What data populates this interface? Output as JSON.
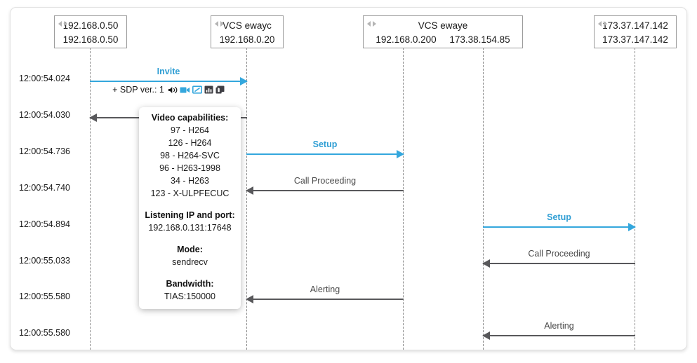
{
  "diagram": {
    "type": "call-flow-ladder-diagram",
    "accent_blue": "#34a7dd",
    "arrow_gray": "#58585b",
    "participants": [
      {
        "id": "endpoint-a",
        "title": "192.168.0.50",
        "addresses": [
          "192.168.0.50"
        ],
        "has_nav_arrows": true
      },
      {
        "id": "vcs-ewayc",
        "title": "VCS ewayc",
        "addresses": [
          "192.168.0.20"
        ],
        "has_nav_arrows": true
      },
      {
        "id": "vcs-ewaye",
        "title": "VCS ewaye",
        "addresses": [
          "192.168.0.200",
          "173.38.154.85"
        ],
        "has_nav_arrows": true
      },
      {
        "id": "endpoint-b",
        "title": "173.37.147.142",
        "addresses": [
          "173.37.147.142"
        ],
        "has_nav_arrows": true
      }
    ],
    "timestamps": [
      "12:00:54.024",
      "12:00:54.030",
      "12:00:54.736",
      "12:00:54.740",
      "12:00:54.894",
      "12:00:55.033",
      "12:00:55.580",
      "12:00:55.580"
    ],
    "messages": [
      {
        "label": "Invite",
        "sublabel": "+ SDP ver.: 1",
        "icons": [
          "audio-speaker-icon",
          "video-camera-icon",
          "presentation-screen-icon",
          "chart-icon",
          "share-document-icon"
        ],
        "direction": "right",
        "color": "blue",
        "from": "endpoint-a",
        "to": "vcs-ewayc"
      },
      {
        "label": "",
        "direction": "left",
        "color": "gray",
        "from": "vcs-ewayc",
        "to": "endpoint-a"
      },
      {
        "label": "Setup",
        "direction": "right",
        "color": "blue",
        "from": "vcs-ewayc",
        "to": "vcs-ewaye"
      },
      {
        "label": "Call Proceeding",
        "direction": "left",
        "color": "gray",
        "from": "vcs-ewaye",
        "to": "vcs-ewayc"
      },
      {
        "label": "Setup",
        "direction": "right",
        "color": "blue",
        "from": "vcs-ewaye",
        "to": "endpoint-b"
      },
      {
        "label": "Call Proceeding",
        "direction": "left",
        "color": "gray",
        "from": "endpoint-b",
        "to": "vcs-ewaye"
      },
      {
        "label": "Alerting",
        "direction": "left",
        "color": "gray",
        "from": "vcs-ewaye",
        "to": "vcs-ewayc"
      },
      {
        "label": "Alerting",
        "direction": "left",
        "color": "gray",
        "from": "endpoint-b",
        "to": "vcs-ewaye"
      }
    ]
  },
  "detail_popup": {
    "video_caps_title": "Video capabilities:",
    "video_caps": [
      "97 - H264",
      "126 - H264",
      "98 - H264-SVC",
      "96 - H263-1998",
      "34 - H263",
      "123 - X-ULPFECUC"
    ],
    "listening_title": "Listening IP and port:",
    "listening_value": "192.168.0.131:17648",
    "mode_title": "Mode:",
    "mode_value": "sendrecv",
    "bandwidth_title": "Bandwidth:",
    "bandwidth_value": "TIAS:150000"
  }
}
